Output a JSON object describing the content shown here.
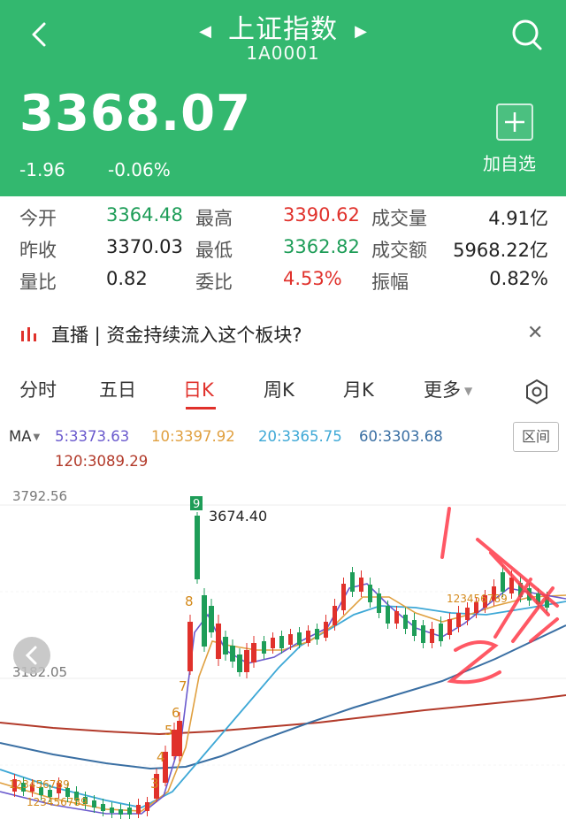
{
  "header": {
    "title": "上证指数",
    "code": "1A0001",
    "price": "3368.07",
    "change": "-1.96",
    "change_pct": "-0.06%",
    "add_label": "加自选"
  },
  "stats": {
    "open_label": "今开",
    "open": "3364.48",
    "high_label": "最高",
    "high": "3390.62",
    "volume_label": "成交量",
    "volume": "4.91亿",
    "prev_label": "昨收",
    "prev": "3370.03",
    "low_label": "最低",
    "low": "3362.82",
    "amount_label": "成交额",
    "amount": "5968.22亿",
    "vr_label": "量比",
    "vr": "0.82",
    "wb_label": "委比",
    "wb": "4.53%",
    "amp_label": "振幅",
    "amp": "0.82%"
  },
  "live": {
    "text": "直播 | 资金持续流入这个板块?"
  },
  "tabs": [
    "分时",
    "五日",
    "日K",
    "周K",
    "月K",
    "更多"
  ],
  "ma": {
    "label": "MA",
    "ma5": "5:3373.63",
    "ma10": "10:3397.92",
    "ma20": "20:3365.75",
    "ma60": "60:3303.68",
    "ma120": "120:3089.29",
    "range_button": "区间"
  },
  "colors": {
    "header_green": "#33b86f",
    "up_red": "#e0312b",
    "down_green": "#1e9d58",
    "ma5": "#6a5acd",
    "ma10": "#e0a040",
    "ma20": "#3ea8d6",
    "ma60": "#3a6fa3",
    "ma120": "#b23a2a"
  },
  "chart_data": {
    "type": "candlestick",
    "y_top_label": "3792.56",
    "y_mid_label": "3182.05",
    "peak_label": "3674.40",
    "td_up_counts": [
      "3",
      "4",
      "5",
      "6",
      "7",
      "8",
      "9"
    ],
    "td_small_labels": "123456789",
    "annotations": [
      "1",
      "2"
    ]
  }
}
